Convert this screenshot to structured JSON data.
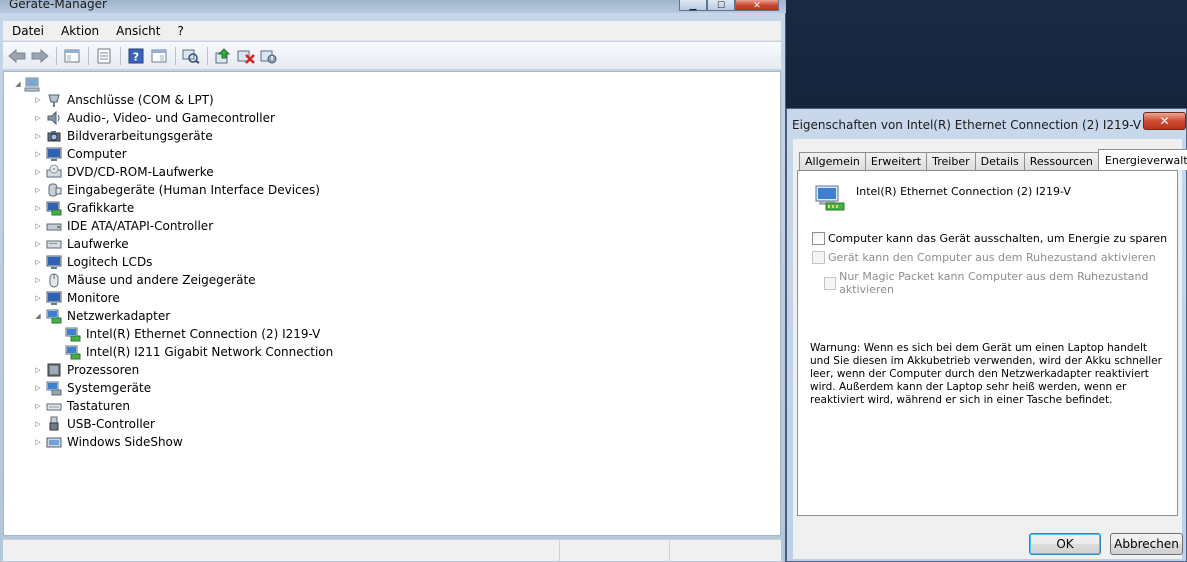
{
  "device_manager": {
    "title": "Geräte-Manager",
    "window_buttons": {
      "minimize": "▁",
      "maximize": "☐",
      "close": "✕"
    },
    "menu": [
      "Datei",
      "Aktion",
      "Ansicht",
      "?"
    ],
    "toolbar_icons": [
      "back-arrow-icon",
      "forward-arrow-icon",
      "show-hide-console-tree-icon",
      "properties-icon",
      "help-icon",
      "show-hide-action-pane-icon",
      "scan-hardware-changes-icon",
      "update-driver-icon",
      "uninstall-icon",
      "disable-device-icon"
    ],
    "tree": {
      "root_icon": "computer-icon",
      "categories": [
        {
          "label": "Anschlüsse (COM & LPT)",
          "icon": "port-icon",
          "expanded": false
        },
        {
          "label": "Audio-, Video- und Gamecontroller",
          "icon": "speaker-icon",
          "expanded": false
        },
        {
          "label": "Bildverarbeitungsgeräte",
          "icon": "camera-icon",
          "expanded": false
        },
        {
          "label": "Computer",
          "icon": "monitor-icon",
          "expanded": false
        },
        {
          "label": "DVD/CD-ROM-Laufwerke",
          "icon": "dvd-drive-icon",
          "expanded": false
        },
        {
          "label": "Eingabegeräte (Human Interface Devices)",
          "icon": "hid-icon",
          "expanded": false
        },
        {
          "label": "Grafikkarte",
          "icon": "display-adapter-icon",
          "expanded": false
        },
        {
          "label": "IDE ATA/ATAPI-Controller",
          "icon": "ide-controller-icon",
          "expanded": false
        },
        {
          "label": "Laufwerke",
          "icon": "disk-drive-icon",
          "expanded": false
        },
        {
          "label": "Logitech LCDs",
          "icon": "lcd-icon",
          "expanded": false
        },
        {
          "label": "Mäuse und andere Zeigegeräte",
          "icon": "mouse-icon",
          "expanded": false
        },
        {
          "label": "Monitore",
          "icon": "monitor-icon",
          "expanded": false
        },
        {
          "label": "Netzwerkadapter",
          "icon": "network-adapter-icon",
          "expanded": true,
          "children": [
            {
              "label": "Intel(R) Ethernet Connection (2) I219-V",
              "icon": "network-adapter-icon"
            },
            {
              "label": "Intel(R) I211 Gigabit Network Connection",
              "icon": "network-adapter-icon"
            }
          ]
        },
        {
          "label": "Prozessoren",
          "icon": "processor-icon",
          "expanded": false
        },
        {
          "label": "Systemgeräte",
          "icon": "system-device-icon",
          "expanded": false
        },
        {
          "label": "Tastaturen",
          "icon": "keyboard-icon",
          "expanded": false
        },
        {
          "label": "USB-Controller",
          "icon": "usb-icon",
          "expanded": false
        },
        {
          "label": "Windows SideShow",
          "icon": "sideshow-icon",
          "expanded": false
        }
      ]
    }
  },
  "properties_dialog": {
    "title": "Eigenschaften von Intel(R) Ethernet Connection (2) I219-V",
    "close_label": "✕",
    "tabs": [
      "Allgemein",
      "Erweitert",
      "Treiber",
      "Details",
      "Ressourcen",
      "Energieverwaltung"
    ],
    "active_tab": "Energieverwaltung",
    "device_name": "Intel(R) Ethernet Connection (2) I219-V",
    "options": [
      {
        "label": "Computer kann das Gerät ausschalten, um Energie zu sparen",
        "checked": false,
        "enabled": true
      },
      {
        "label": "Gerät kann den Computer aus dem Ruhezustand aktivieren",
        "checked": false,
        "enabled": false
      },
      {
        "label": "Nur Magic Packet kann Computer aus dem Ruhezustand aktivieren",
        "checked": false,
        "enabled": false
      }
    ],
    "warning": "Warnung: Wenn es sich bei dem Gerät um einen Laptop handelt und Sie diesen im Akkubetrieb verwenden, wird der Akku schneller leer, wenn der Computer durch den Netzwerkadapter reaktiviert wird. Außerdem kann der Laptop sehr heiß werden, wenn er reaktiviert wird, während er sich in einer Tasche befindet.",
    "ok_label": "OK",
    "cancel_label": "Abbrechen"
  }
}
